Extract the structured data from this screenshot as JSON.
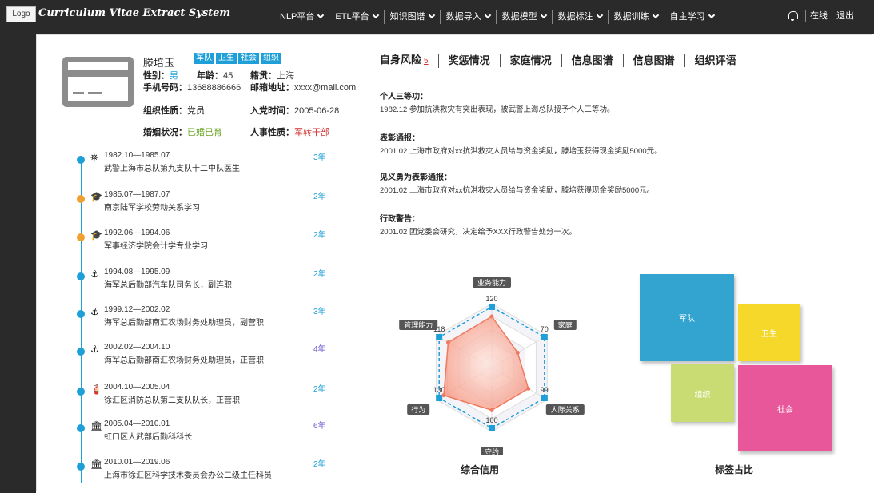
{
  "app": {
    "logo": "Logo",
    "title": "Curriculum Vitae Extract System"
  },
  "nav": {
    "items": [
      {
        "label": "NLP平台"
      },
      {
        "label": "ETL平台"
      },
      {
        "label": "知识图谱"
      },
      {
        "label": "数据导入"
      },
      {
        "label": "数据模型"
      },
      {
        "label": "数据标注"
      },
      {
        "label": "数据训练"
      },
      {
        "label": "自主学习"
      }
    ],
    "online": "在线",
    "logout": "退出"
  },
  "profile": {
    "name": "滕培玉",
    "tags": [
      "军队",
      "卫生",
      "社会",
      "组织"
    ],
    "gender_label": "性别：",
    "gender": "男",
    "age_label": "年龄：",
    "age": "45",
    "origin_label": "籍贯：",
    "origin": "上海",
    "phone_label": "手机号码：",
    "phone": "13688886666",
    "email_label": "邮箱地址：",
    "email": "xxxx@mail.com",
    "org_label": "组织性质：",
    "org": "党员",
    "join_label": "入党时间：",
    "join": "2005-06-28",
    "marital_label": "婚姻状况：",
    "marital": "已婚已育",
    "hr_label": "人事性质：",
    "hr": "军转干部"
  },
  "timeline": [
    {
      "date": "1982.10—1985.07",
      "desc": "武警上海市总队第九支队十二中队医生",
      "dur": "3年",
      "color": "#1e9fd8",
      "icon": "binoculars-icon",
      "glyph": "⛯"
    },
    {
      "date": "1985.07—1987.07",
      "desc": "南京陆军学校劳动关系学习",
      "dur": "2年",
      "color": "#f0a030",
      "icon": "graduation-cap-icon",
      "glyph": "🎓"
    },
    {
      "date": "1992.06—1994.06",
      "desc": "军事经济学院会计学专业学习",
      "dur": "2年",
      "color": "#f0a030",
      "icon": "graduation-cap-icon",
      "glyph": "🎓"
    },
    {
      "date": "1994.08—1995.09",
      "desc": "海军总后勤部汽车队司务长，副连职",
      "dur": "2年",
      "color": "#1e9fd8",
      "icon": "anchor-icon",
      "glyph": "⚓"
    },
    {
      "date": "1999.12—2002.02",
      "desc": "海军总后勤部南汇农场财务处助理员，副营职",
      "dur": "3年",
      "color": "#1e9fd8",
      "icon": "anchor-icon",
      "glyph": "⚓"
    },
    {
      "date": "2002.02—2004.10",
      "desc": "海军总后勤部南汇农场财务处助理员，正营职",
      "dur": "4年",
      "color": "#1e9fd8",
      "icon": "anchor-icon",
      "glyph": "⚓"
    },
    {
      "date": "2004.10—2005.04",
      "desc": "徐汇区消防总队第二支队队长，正营职",
      "dur": "2年",
      "color": "#1e9fd8",
      "icon": "fire-extinguisher-icon",
      "glyph": "🧯"
    },
    {
      "date": "2005.04—2010.01",
      "desc": "虹口区人武部后勤科科长",
      "dur": "6年",
      "color": "#1e9fd8",
      "icon": "bank-icon",
      "glyph": "🏛"
    },
    {
      "date": "2010.01—2019.06",
      "desc": "上海市徐汇区科学技术委员会办公二级主任科员",
      "dur": "2年",
      "color": "#1e9fd8",
      "icon": "bank-icon",
      "glyph": "🏛"
    }
  ],
  "tabs": [
    {
      "label": "自身风险",
      "badge": "5"
    },
    {
      "label": "奖惩情况"
    },
    {
      "label": "家庭情况"
    },
    {
      "label": "信息图谱"
    },
    {
      "label": "信息图谱"
    },
    {
      "label": "组织评语"
    }
  ],
  "records": [
    {
      "title": "个人三等功：",
      "text": "1982.12 参加抗洪救灾有突出表现，被武警上海总队授予个人三等功。"
    },
    {
      "title": "表彰通报：",
      "text": "2001.02 上海市政府对xx抗洪救灾人员给与资金奖励，滕培玉获得现金奖励5000元。"
    },
    {
      "title": "见义勇为表彰通报：",
      "text": "2001.02 上海市政府对xx抗洪救灾人员给与资金奖励，滕培获得现金奖励5000元。"
    },
    {
      "title": "行政警告：",
      "text": "2001.02 团党委会研究，决定给予XXX行政警告处分一次。"
    }
  ],
  "radar": {
    "title": "综合信用",
    "indicators": [
      "业务能力",
      "家庭",
      "人际关系",
      "守约",
      "行为",
      "管理能力"
    ],
    "values": [
      120,
      70,
      99,
      100,
      130,
      118
    ],
    "colors": {
      "fill": "#f5907a",
      "line": "#1e9fd8"
    }
  },
  "treemap": {
    "title": "标签占比",
    "items": [
      {
        "label": "军队",
        "color": "#33a4cf"
      },
      {
        "label": "卫生",
        "color": "#f5d82a"
      },
      {
        "label": "组织",
        "color": "#c8dc73"
      },
      {
        "label": "社会",
        "color": "#e9579b"
      }
    ]
  }
}
